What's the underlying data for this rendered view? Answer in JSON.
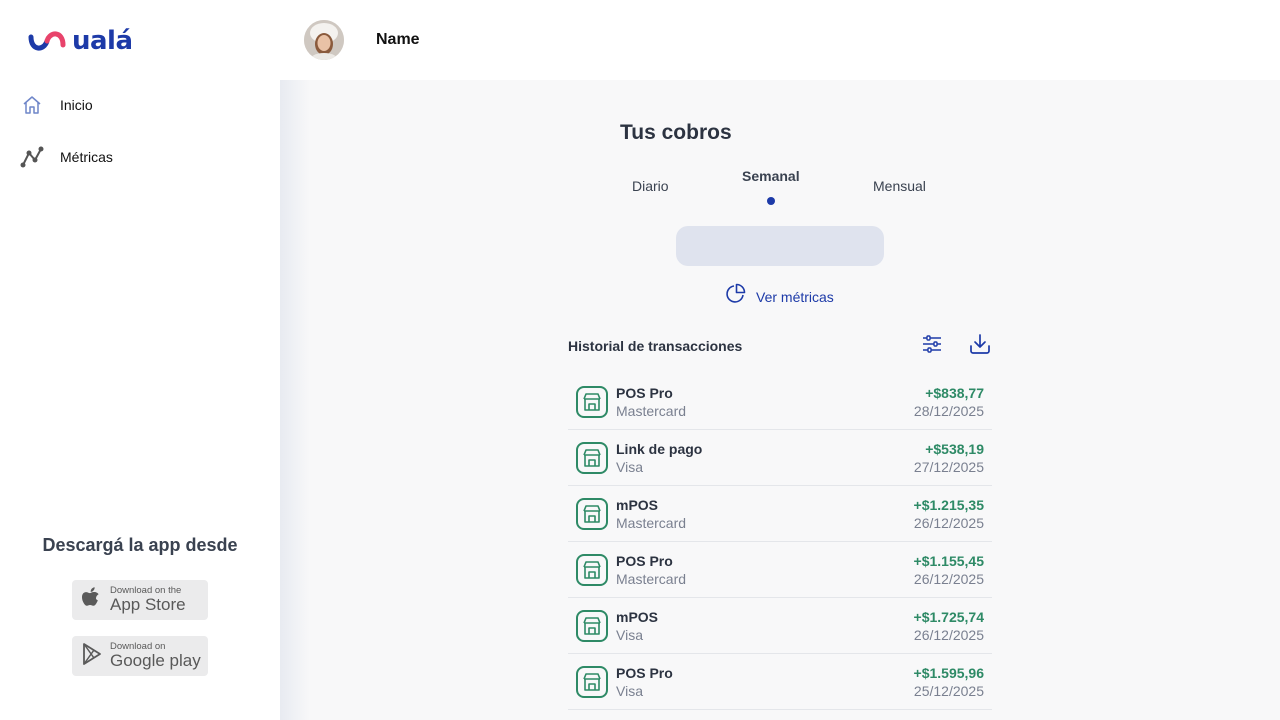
{
  "brand": {
    "logo_text": "ualá",
    "color": "#1d3aa8",
    "accent": "#e8436b"
  },
  "sidebar": {
    "items": [
      {
        "label": "Inicio",
        "icon": "home-icon"
      },
      {
        "label": "Métricas",
        "icon": "metrics-icon"
      }
    ],
    "download_title": "Descargá la app desde",
    "appstore": {
      "small": "Download on the",
      "big": "App Store"
    },
    "googleplay": {
      "small": "Download on",
      "big": "Google play"
    }
  },
  "header": {
    "user_name": "Name"
  },
  "main": {
    "title": "Tus cobros",
    "tabs": [
      {
        "label": "Diario",
        "active": false
      },
      {
        "label": "Semanal",
        "active": true
      },
      {
        "label": "Mensual",
        "active": false
      }
    ],
    "ver_metricas": "Ver métricas",
    "history_title": "Historial de transacciones",
    "transactions": [
      {
        "name": "POS Pro",
        "brand": "Mastercard",
        "amount": "+$838,77",
        "date": "28/12/2025"
      },
      {
        "name": "Link de pago",
        "brand": "Visa",
        "amount": "+$538,19",
        "date": "27/12/2025"
      },
      {
        "name": "mPOS",
        "brand": "Mastercard",
        "amount": "+$1.215,35",
        "date": "26/12/2025"
      },
      {
        "name": "POS Pro",
        "brand": "Mastercard",
        "amount": "+$1.155,45",
        "date": "26/12/2025"
      },
      {
        "name": "mPOS",
        "brand": "Visa",
        "amount": "+$1.725,74",
        "date": "26/12/2025"
      },
      {
        "name": "POS Pro",
        "brand": "Visa",
        "amount": "+$1.595,96",
        "date": "25/12/2025"
      }
    ]
  }
}
